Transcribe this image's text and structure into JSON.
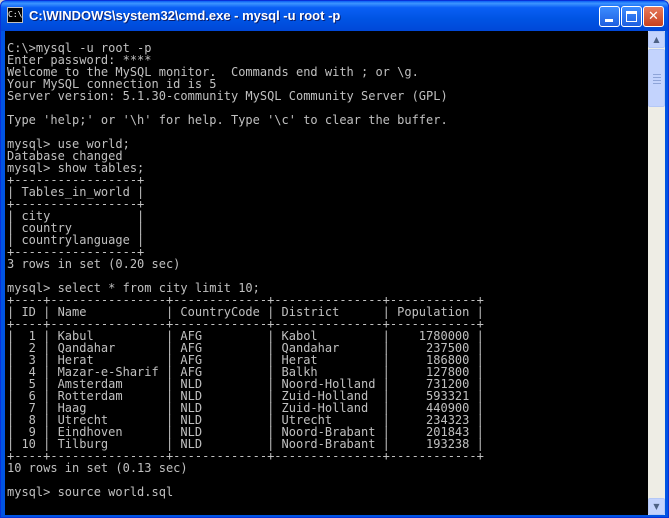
{
  "window": {
    "title": "C:\\WINDOWS\\system32\\cmd.exe - mysql -u root -p",
    "icon": "cmd-icon",
    "icon_text": "C:\\"
  },
  "console": {
    "lines": [
      "C:\\>mysql -u root -p",
      "Enter password: ****",
      "Welcome to the MySQL monitor.  Commands end with ; or \\g.",
      "Your MySQL connection id is 5",
      "Server version: 5.1.30-community MySQL Community Server (GPL)",
      "",
      "Type 'help;' or '\\h' for help. Type '\\c' to clear the buffer.",
      "",
      "mysql> use world;",
      "Database changed",
      "mysql> show tables;",
      "+-----------------+",
      "| Tables_in_world |",
      "+-----------------+",
      "| city            |",
      "| country         |",
      "| countrylanguage |",
      "+-----------------+",
      "3 rows in set (0.20 sec)",
      "",
      "mysql> select * from city limit 10;",
      "+----+----------------+-------------+---------------+------------+",
      "| ID | Name           | CountryCode | District      | Population |",
      "+----+----------------+-------------+---------------+------------+",
      "|  1 | Kabul          | AFG         | Kabol         |    1780000 |",
      "|  2 | Qandahar       | AFG         | Qandahar      |     237500 |",
      "|  3 | Herat          | AFG         | Herat         |     186800 |",
      "|  4 | Mazar-e-Sharif | AFG         | Balkh         |     127800 |",
      "|  5 | Amsterdam      | NLD         | Noord-Holland |     731200 |",
      "|  6 | Rotterdam      | NLD         | Zuid-Holland  |     593321 |",
      "|  7 | Haag           | NLD         | Zuid-Holland  |     440900 |",
      "|  8 | Utrecht        | NLD         | Utrecht       |     234323 |",
      "|  9 | Eindhoven      | NLD         | Noord-Brabant |     201843 |",
      "| 10 | Tilburg        | NLD         | Noord-Brabant |     193238 |",
      "+----+----------------+-------------+---------------+------------+",
      "10 rows in set (0.13 sec)",
      "",
      "mysql> source world.sql"
    ]
  },
  "colors": {
    "console_bg": "#000000",
    "console_text": "#c0c0c0",
    "titlebar": "#0054e3"
  }
}
